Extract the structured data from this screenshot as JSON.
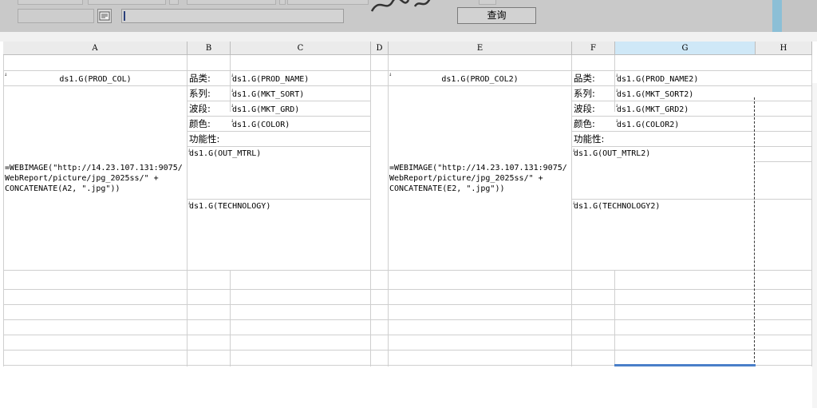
{
  "toolbar": {
    "icon_name": "formula-editor-icon",
    "expression_value": "",
    "query_label": "查询"
  },
  "columns": [
    "A",
    "B",
    "C",
    "D",
    "E",
    "F",
    "G",
    "H"
  ],
  "selected_column": "G",
  "left_block": {
    "col_cell": "ds1.G(PROD_COL)",
    "image_formula": "=WEBIMAGE(\"http://14.23.107.131:9075/\nWebReport/picture/jpg_2025ss/\" +\nCONCATENATE(A2, \".jpg\"))",
    "labels": [
      "品类:",
      "系列:",
      "波段:",
      "颜色:",
      "功能性:"
    ],
    "fields": [
      "ds1.G(PROD_NAME)",
      "ds1.G(MKT_SORT)",
      "ds1.G(MKT_GRD)",
      "ds1.G(COLOR)",
      ""
    ],
    "out_mtrl": "ds1.G(OUT_MTRL)",
    "technology": "ds1.G(TECHNOLOGY)"
  },
  "right_block": {
    "col_cell": "ds1.G(PROD_COL2)",
    "image_formula": "=WEBIMAGE(\"http://14.23.107.131:9075/\nWebReport/picture/jpg_2025ss/\" +\nCONCATENATE(E2, \".jpg\"))",
    "labels": [
      "品类:",
      "系列:",
      "波段:",
      "颜色:",
      "功能性:"
    ],
    "fields": [
      "ds1.G(PROD_NAME2)",
      "ds1.G(MKT_SORT2)",
      "ds1.G(MKT_GRD2)",
      "ds1.G(COLOR2)",
      ""
    ],
    "out_mtrl": "ds1.G(OUT_MTRL2)",
    "technology": "ds1.G(TECHNOLOGY2)"
  }
}
